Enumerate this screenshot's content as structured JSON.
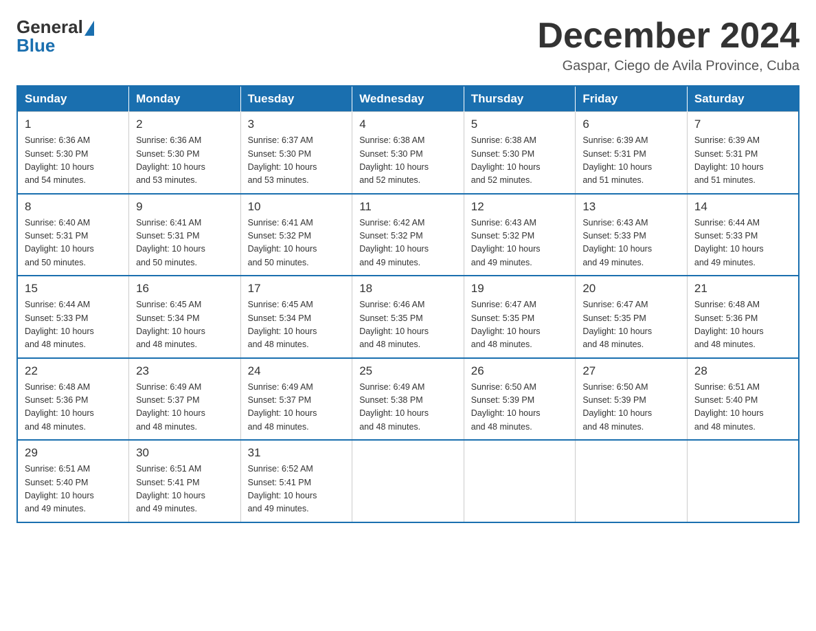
{
  "logo": {
    "general": "General",
    "blue": "Blue"
  },
  "header": {
    "month_year": "December 2024",
    "location": "Gaspar, Ciego de Avila Province, Cuba"
  },
  "days_of_week": [
    "Sunday",
    "Monday",
    "Tuesday",
    "Wednesday",
    "Thursday",
    "Friday",
    "Saturday"
  ],
  "weeks": [
    [
      {
        "day": "1",
        "sunrise": "6:36 AM",
        "sunset": "5:30 PM",
        "daylight": "10 hours and 54 minutes."
      },
      {
        "day": "2",
        "sunrise": "6:36 AM",
        "sunset": "5:30 PM",
        "daylight": "10 hours and 53 minutes."
      },
      {
        "day": "3",
        "sunrise": "6:37 AM",
        "sunset": "5:30 PM",
        "daylight": "10 hours and 53 minutes."
      },
      {
        "day": "4",
        "sunrise": "6:38 AM",
        "sunset": "5:30 PM",
        "daylight": "10 hours and 52 minutes."
      },
      {
        "day": "5",
        "sunrise": "6:38 AM",
        "sunset": "5:30 PM",
        "daylight": "10 hours and 52 minutes."
      },
      {
        "day": "6",
        "sunrise": "6:39 AM",
        "sunset": "5:31 PM",
        "daylight": "10 hours and 51 minutes."
      },
      {
        "day": "7",
        "sunrise": "6:39 AM",
        "sunset": "5:31 PM",
        "daylight": "10 hours and 51 minutes."
      }
    ],
    [
      {
        "day": "8",
        "sunrise": "6:40 AM",
        "sunset": "5:31 PM",
        "daylight": "10 hours and 50 minutes."
      },
      {
        "day": "9",
        "sunrise": "6:41 AM",
        "sunset": "5:31 PM",
        "daylight": "10 hours and 50 minutes."
      },
      {
        "day": "10",
        "sunrise": "6:41 AM",
        "sunset": "5:32 PM",
        "daylight": "10 hours and 50 minutes."
      },
      {
        "day": "11",
        "sunrise": "6:42 AM",
        "sunset": "5:32 PM",
        "daylight": "10 hours and 49 minutes."
      },
      {
        "day": "12",
        "sunrise": "6:43 AM",
        "sunset": "5:32 PM",
        "daylight": "10 hours and 49 minutes."
      },
      {
        "day": "13",
        "sunrise": "6:43 AM",
        "sunset": "5:33 PM",
        "daylight": "10 hours and 49 minutes."
      },
      {
        "day": "14",
        "sunrise": "6:44 AM",
        "sunset": "5:33 PM",
        "daylight": "10 hours and 49 minutes."
      }
    ],
    [
      {
        "day": "15",
        "sunrise": "6:44 AM",
        "sunset": "5:33 PM",
        "daylight": "10 hours and 48 minutes."
      },
      {
        "day": "16",
        "sunrise": "6:45 AM",
        "sunset": "5:34 PM",
        "daylight": "10 hours and 48 minutes."
      },
      {
        "day": "17",
        "sunrise": "6:45 AM",
        "sunset": "5:34 PM",
        "daylight": "10 hours and 48 minutes."
      },
      {
        "day": "18",
        "sunrise": "6:46 AM",
        "sunset": "5:35 PM",
        "daylight": "10 hours and 48 minutes."
      },
      {
        "day": "19",
        "sunrise": "6:47 AM",
        "sunset": "5:35 PM",
        "daylight": "10 hours and 48 minutes."
      },
      {
        "day": "20",
        "sunrise": "6:47 AM",
        "sunset": "5:35 PM",
        "daylight": "10 hours and 48 minutes."
      },
      {
        "day": "21",
        "sunrise": "6:48 AM",
        "sunset": "5:36 PM",
        "daylight": "10 hours and 48 minutes."
      }
    ],
    [
      {
        "day": "22",
        "sunrise": "6:48 AM",
        "sunset": "5:36 PM",
        "daylight": "10 hours and 48 minutes."
      },
      {
        "day": "23",
        "sunrise": "6:49 AM",
        "sunset": "5:37 PM",
        "daylight": "10 hours and 48 minutes."
      },
      {
        "day": "24",
        "sunrise": "6:49 AM",
        "sunset": "5:37 PM",
        "daylight": "10 hours and 48 minutes."
      },
      {
        "day": "25",
        "sunrise": "6:49 AM",
        "sunset": "5:38 PM",
        "daylight": "10 hours and 48 minutes."
      },
      {
        "day": "26",
        "sunrise": "6:50 AM",
        "sunset": "5:39 PM",
        "daylight": "10 hours and 48 minutes."
      },
      {
        "day": "27",
        "sunrise": "6:50 AM",
        "sunset": "5:39 PM",
        "daylight": "10 hours and 48 minutes."
      },
      {
        "day": "28",
        "sunrise": "6:51 AM",
        "sunset": "5:40 PM",
        "daylight": "10 hours and 48 minutes."
      }
    ],
    [
      {
        "day": "29",
        "sunrise": "6:51 AM",
        "sunset": "5:40 PM",
        "daylight": "10 hours and 49 minutes."
      },
      {
        "day": "30",
        "sunrise": "6:51 AM",
        "sunset": "5:41 PM",
        "daylight": "10 hours and 49 minutes."
      },
      {
        "day": "31",
        "sunrise": "6:52 AM",
        "sunset": "5:41 PM",
        "daylight": "10 hours and 49 minutes."
      },
      null,
      null,
      null,
      null
    ]
  ],
  "labels": {
    "sunrise": "Sunrise:",
    "sunset": "Sunset:",
    "daylight": "Daylight:"
  }
}
